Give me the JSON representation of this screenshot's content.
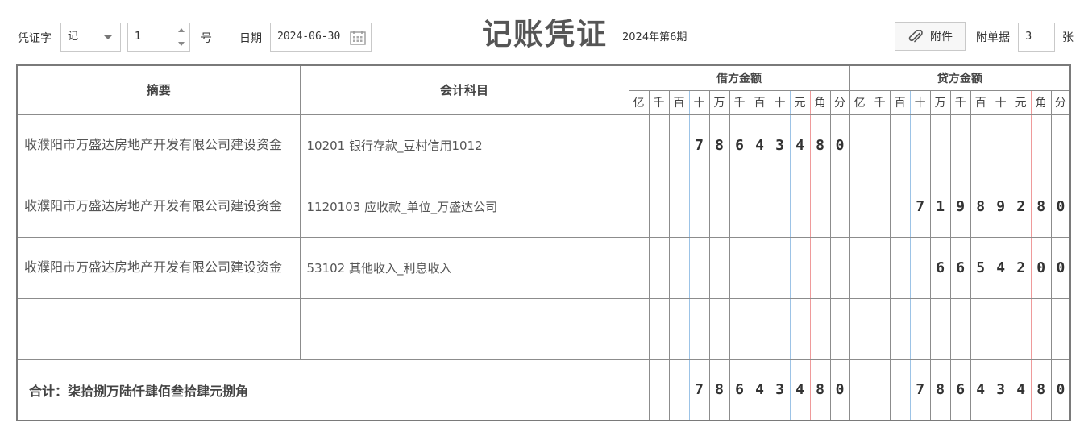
{
  "header": {
    "voucher_word_label": "凭证字",
    "voucher_word_value": "记",
    "voucher_number_value": "1",
    "number_suffix": "号",
    "date_label": "日期",
    "date_value": "2024-06-30",
    "title": "记账凭证",
    "period": "2024年第6期",
    "attach_button_label": "附件",
    "attach_docs_label": "附单据",
    "attach_docs_value": "3",
    "attach_docs_unit": "张"
  },
  "table": {
    "col_summary": "摘要",
    "col_account": "会计科目",
    "debit_header": "借方金额",
    "credit_header": "贷方金额",
    "units": [
      "亿",
      "千",
      "百",
      "十",
      "万",
      "千",
      "百",
      "十",
      "元",
      "角",
      "分"
    ],
    "rows": [
      {
        "summary": "收濮阳市万盛达房地产开发有限公司建设资金",
        "account": "10201 银行存款_豆村信用1012",
        "debit": [
          "",
          "",
          "",
          "7",
          "8",
          "6",
          "4",
          "3",
          "4",
          "8",
          "0"
        ],
        "credit": [
          "",
          "",
          "",
          "",
          "",
          "",
          "",
          "",
          "",
          "",
          ""
        ]
      },
      {
        "summary": "收濮阳市万盛达房地产开发有限公司建设资金",
        "account": "1120103 应收款_单位_万盛达公司",
        "debit": [
          "",
          "",
          "",
          "",
          "",
          "",
          "",
          "",
          "",
          "",
          ""
        ],
        "credit": [
          "",
          "",
          "",
          "7",
          "1",
          "9",
          "8",
          "9",
          "2",
          "8",
          "0"
        ]
      },
      {
        "summary": "收濮阳市万盛达房地产开发有限公司建设资金",
        "account": "53102 其他收入_利息收入",
        "debit": [
          "",
          "",
          "",
          "",
          "",
          "",
          "",
          "",
          "",
          "",
          ""
        ],
        "credit": [
          "",
          "",
          "",
          "",
          "6",
          "6",
          "5",
          "4",
          "2",
          "0",
          "0"
        ]
      },
      {
        "summary": "",
        "account": "",
        "debit": [
          "",
          "",
          "",
          "",
          "",
          "",
          "",
          "",
          "",
          "",
          ""
        ],
        "credit": [
          "",
          "",
          "",
          "",
          "",
          "",
          "",
          "",
          "",
          "",
          ""
        ]
      }
    ],
    "total_label": "合计：柒拾捌万陆仟肆佰叁拾肆元捌角",
    "total_debit": [
      "",
      "",
      "",
      "7",
      "8",
      "6",
      "4",
      "3",
      "4",
      "8",
      "0"
    ],
    "total_credit": [
      "",
      "",
      "",
      "7",
      "8",
      "6",
      "4",
      "3",
      "4",
      "8",
      "0"
    ]
  }
}
